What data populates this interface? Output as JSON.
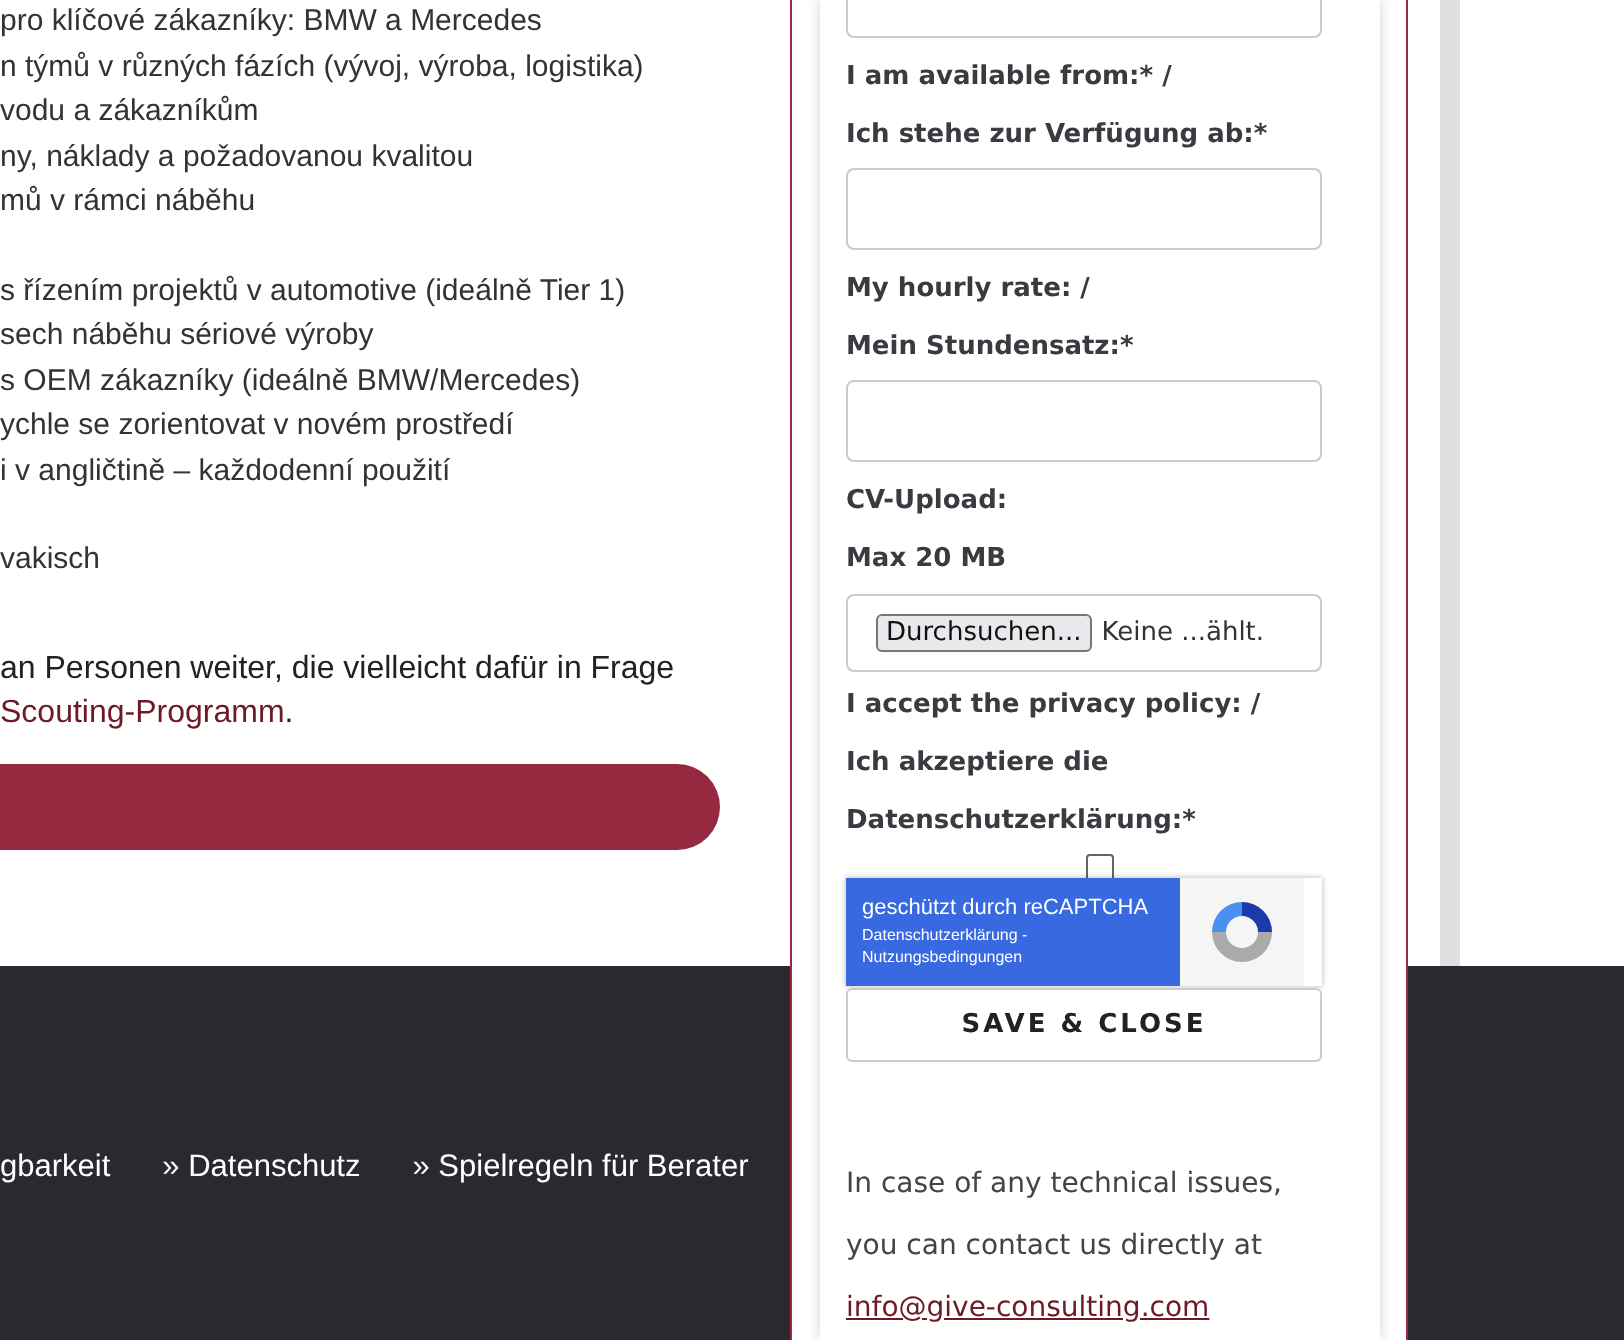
{
  "content_groups": [
    [
      "pro klíčové zákazníky: BMW a Mercedes",
      "n týmů v různých fázích (vývoj, výroba, logistika)",
      "vodu a zákazníkům",
      "ny, náklady a požadovanou kvalitou",
      "mů v rámci náběhu"
    ],
    [
      "s řízením projektů v automotive (ideálně Tier 1)",
      "sech náběhu sériové výroby",
      "s OEM zákazníky (ideálně BMW/Mercedes)",
      "ychle se zorientovat v novém prostředí",
      "i v angličtině – každodenní použití"
    ],
    [
      "vakisch"
    ]
  ],
  "paragraph": {
    "text": "an Personen weiter, die vielleicht dafür in Frage",
    "link": "Scouting-Programm",
    "after": "."
  },
  "footer_links": [
    "gbarkeit",
    "» Datenschutz",
    "» Spielregeln für Berater"
  ],
  "form": [
    {
      "kind": "input"
    },
    {
      "kind": "label",
      "text": "I am available from:* /"
    },
    {
      "kind": "label",
      "text": "Ich stehe zur Verfügung ab:*"
    },
    {
      "kind": "input"
    },
    {
      "kind": "label",
      "text": "My hourly rate: /"
    },
    {
      "kind": "label",
      "text": "Mein Stundensatz:*"
    },
    {
      "kind": "input"
    },
    {
      "kind": "label",
      "text": "CV-Upload:"
    },
    {
      "kind": "label",
      "text": "Max 20 MB"
    },
    {
      "kind": "file",
      "button": "Durchsuchen...",
      "status": "Keine ...ählt."
    },
    {
      "kind": "label",
      "text": "I accept the privacy policy: /"
    },
    {
      "kind": "label",
      "text": "Ich akzeptiere die"
    },
    {
      "kind": "label",
      "text": "Datenschutzerklärung:*"
    },
    {
      "kind": "checkbox",
      "checked": false
    }
  ],
  "recaptcha": {
    "title": "geschützt durch reCAPTCHA",
    "links": "Datenschutzerklärung - Nutzungsbedingungen"
  },
  "save_button": "SAVE & CLOSE",
  "contact": {
    "lines": [
      "In case of any technical issues,",
      "you can contact us directly at"
    ],
    "email": "info@give-consulting.com"
  }
}
